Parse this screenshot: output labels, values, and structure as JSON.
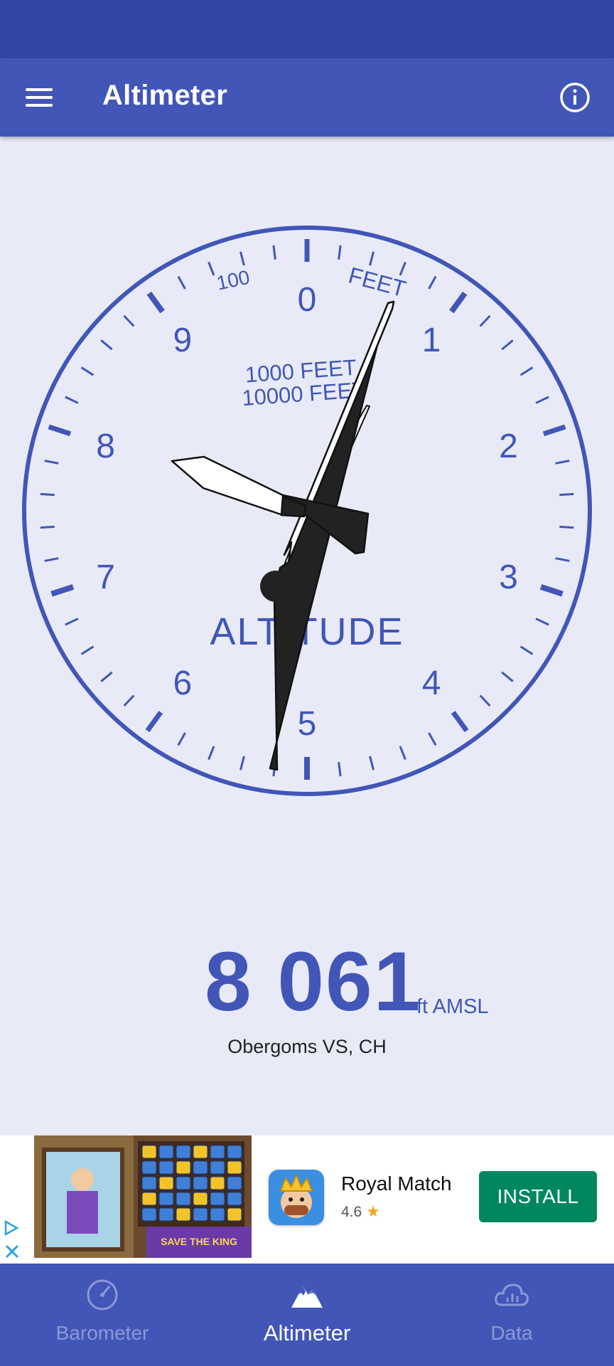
{
  "app_bar": {
    "title": "Altimeter"
  },
  "gauge": {
    "dial_numbers": [
      "0",
      "1",
      "2",
      "3",
      "4",
      "5",
      "6",
      "7",
      "8",
      "9"
    ],
    "label_100": "100",
    "label_feet_top": "FEET",
    "label_1000_feet": "1000 FEET",
    "label_10000_feet": "10000 FEET",
    "label_altitude": "ALTITUDE",
    "altitude_ft": 8061
  },
  "readout": {
    "value": "8 061",
    "unit": "ft AMSL",
    "location": "Obergoms VS, CH"
  },
  "ad": {
    "app_name": "Royal Match",
    "rating": "4.6",
    "rating_star": "★",
    "install_label": "INSTALL",
    "creative_text": "SAVE THE KING"
  },
  "bottom_nav": [
    {
      "label": "Barometer",
      "icon": "gauge-icon",
      "active": false
    },
    {
      "label": "Altimeter",
      "icon": "mountain-icon",
      "active": true
    },
    {
      "label": "Data",
      "icon": "cloud-chart-icon",
      "active": false
    }
  ],
  "colors": {
    "primary": "#4256b8",
    "status_bar": "#3346a6",
    "background": "#e8ebf7",
    "install": "#01875f"
  }
}
